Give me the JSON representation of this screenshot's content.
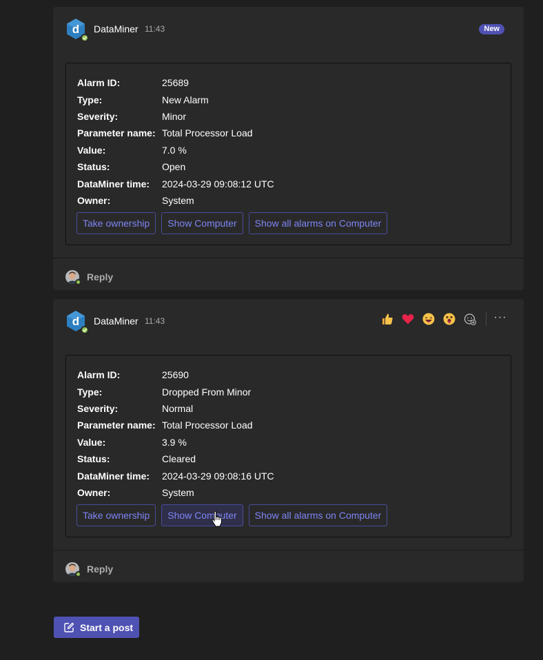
{
  "posts": [
    {
      "author": "DataMiner",
      "time": "11:43",
      "badge": "New",
      "facts": [
        {
          "key": "Alarm ID:",
          "value": "25689"
        },
        {
          "key": "Type:",
          "value": "New Alarm"
        },
        {
          "key": "Severity:",
          "value": "Minor"
        },
        {
          "key": "Parameter name:",
          "value": "Total Processor Load"
        },
        {
          "key": "Value:",
          "value": "7.0 %"
        },
        {
          "key": "Status:",
          "value": "Open"
        },
        {
          "key": "DataMiner time:",
          "value": "2024-03-29 09:08:12 UTC"
        },
        {
          "key": "Owner:",
          "value": "System"
        }
      ],
      "actions": [
        "Take ownership",
        "Show Computer",
        "Show all alarms on Computer"
      ],
      "reply_label": "Reply"
    },
    {
      "author": "DataMiner",
      "time": "11:43",
      "facts": [
        {
          "key": "Alarm ID:",
          "value": "25690"
        },
        {
          "key": "Type:",
          "value": "Dropped From Minor"
        },
        {
          "key": "Severity:",
          "value": "Normal"
        },
        {
          "key": "Parameter name:",
          "value": "Total Processor Load"
        },
        {
          "key": "Value:",
          "value": "3.9 %"
        },
        {
          "key": "Status:",
          "value": "Cleared"
        },
        {
          "key": "DataMiner time:",
          "value": "2024-03-29 09:08:16 UTC"
        },
        {
          "key": "Owner:",
          "value": "System"
        }
      ],
      "actions": [
        "Take ownership",
        "Show Computer",
        "Show all alarms on Computer"
      ],
      "reply_label": "Reply",
      "reactions": [
        "like-icon",
        "heart-icon",
        "laugh-icon",
        "surprised-icon",
        "add-reaction-icon"
      ],
      "more_label": "···"
    }
  ],
  "start_post_label": "Start a post",
  "colors": {
    "accent": "#4f52b2",
    "link": "#7f85f5",
    "presence": "#92c353",
    "background": "#1f1f1f",
    "card": "#292929"
  }
}
